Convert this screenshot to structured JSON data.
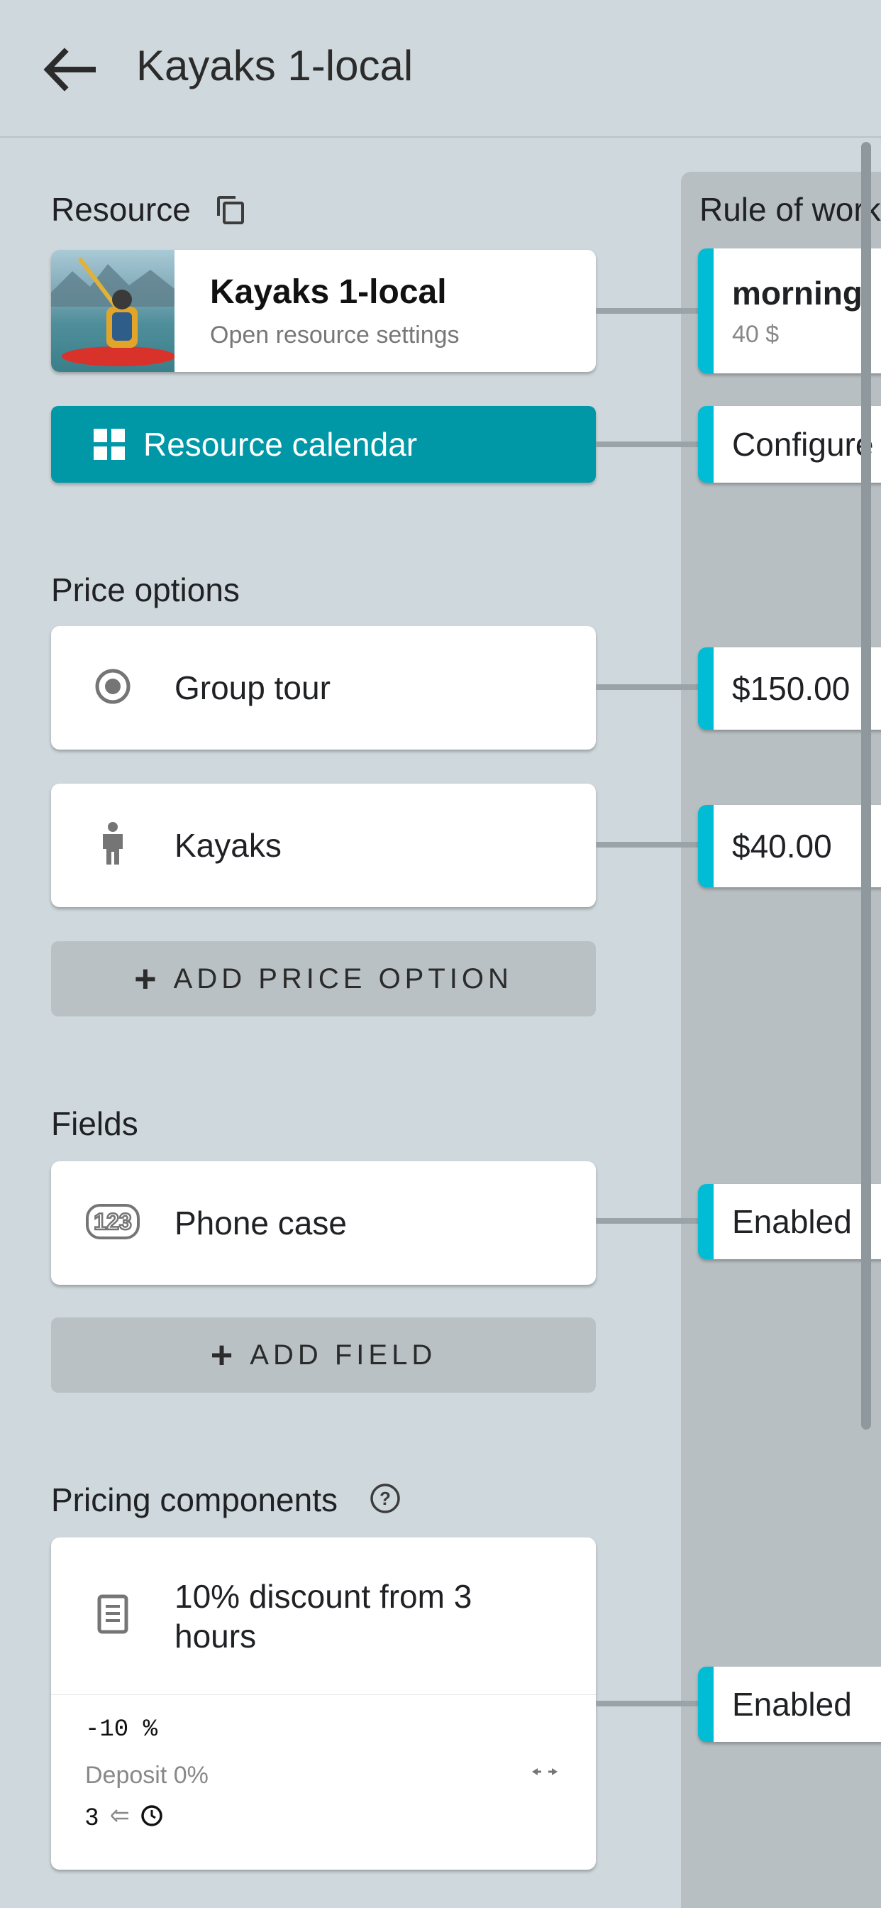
{
  "header": {
    "title": "Kayaks 1-local",
    "back_icon": "arrow-left-icon"
  },
  "resource": {
    "label": "Resource",
    "copy_icon": "copy-icon",
    "card_title": "Kayaks 1-local",
    "card_subtitle": "Open resource settings",
    "thumbnail": "kayaker-photo",
    "calendar_button": "Resource calendar",
    "calendar_icon": "grid-icon"
  },
  "price_options": {
    "label": "Price options",
    "items": [
      {
        "label": "Group tour",
        "icon": "radio-target-icon"
      },
      {
        "label": "Kayaks",
        "icon": "person-icon"
      }
    ],
    "add_label": "ADD PRICE OPTION"
  },
  "fields": {
    "label": "Fields",
    "items": [
      {
        "label": "Phone case",
        "icon": "numeric-123-icon"
      }
    ],
    "add_label": "ADD FIELD"
  },
  "pricing_components": {
    "label": "Pricing components",
    "help_icon": "help-circle-icon",
    "items": [
      {
        "title": "10% discount from 3 hours",
        "icon": "document-icon",
        "value": "-10 %",
        "deposit": "Deposit 0%",
        "condition_value": "3"
      }
    ]
  },
  "right_panel": {
    "title": "Rule of work",
    "cards": [
      {
        "title": "morning",
        "subtitle": "40 $"
      },
      {
        "title": "Configure"
      },
      {
        "title": "$150.00"
      },
      {
        "title": "$40.00"
      },
      {
        "title": "Enabled"
      },
      {
        "title": "Enabled"
      }
    ]
  },
  "colors": {
    "background": "#cfd8dc",
    "accent": "#0097a7",
    "rule_accent": "#00bcd4",
    "panel": "#b7bfc2"
  }
}
